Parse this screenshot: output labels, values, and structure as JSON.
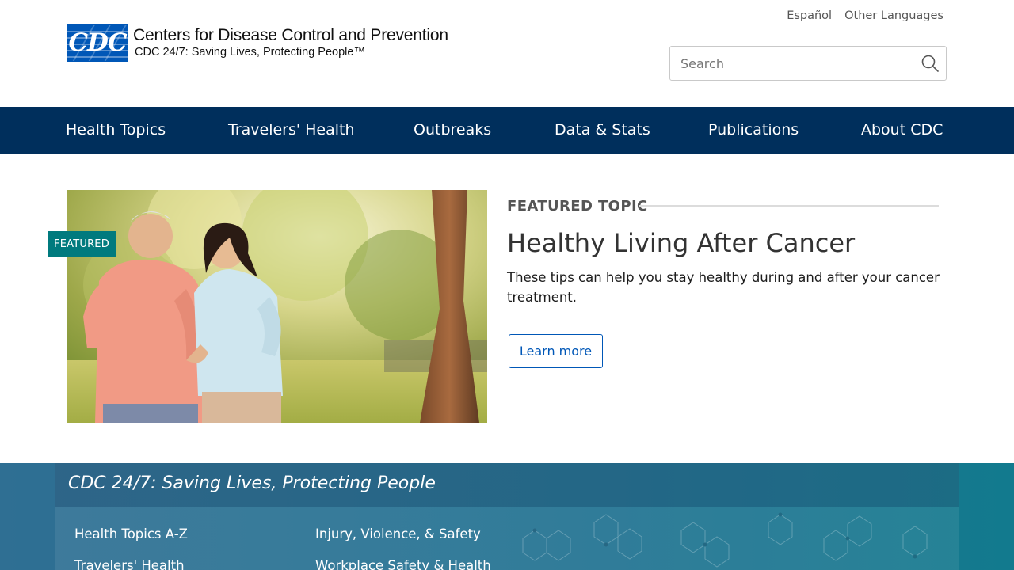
{
  "header": {
    "logo_mark": "CDC",
    "org_name": "Centers for Disease Control and Prevention",
    "tagline": "CDC 24/7: Saving Lives, Protecting People™",
    "lang_links": [
      "Español",
      "Other Languages"
    ],
    "search_placeholder": "Search"
  },
  "nav": {
    "items": [
      "Health Topics",
      "Travelers' Health",
      "Outbreaks",
      "Data & Stats",
      "Publications",
      "About CDC"
    ]
  },
  "featured": {
    "badge": "FEATURED",
    "label": "FEATURED TOPIC",
    "title": "Healthy Living After Cancer",
    "description": "These tips can help you stay healthy during and after your cancer treatment.",
    "button": "Learn more"
  },
  "footer": {
    "tagline": "CDC 24/7: Saving Lives, Protecting People",
    "links_col1": [
      "Health Topics A-Z",
      "Travelers' Health"
    ],
    "links_col2": [
      "Injury, Violence, & Safety",
      "Workplace Safety & Health"
    ]
  },
  "colors": {
    "nav_bg": "#002f5c",
    "brand_blue": "#0057b7",
    "badge_teal": "#007a7e",
    "footer_teal": "#1f7191"
  }
}
